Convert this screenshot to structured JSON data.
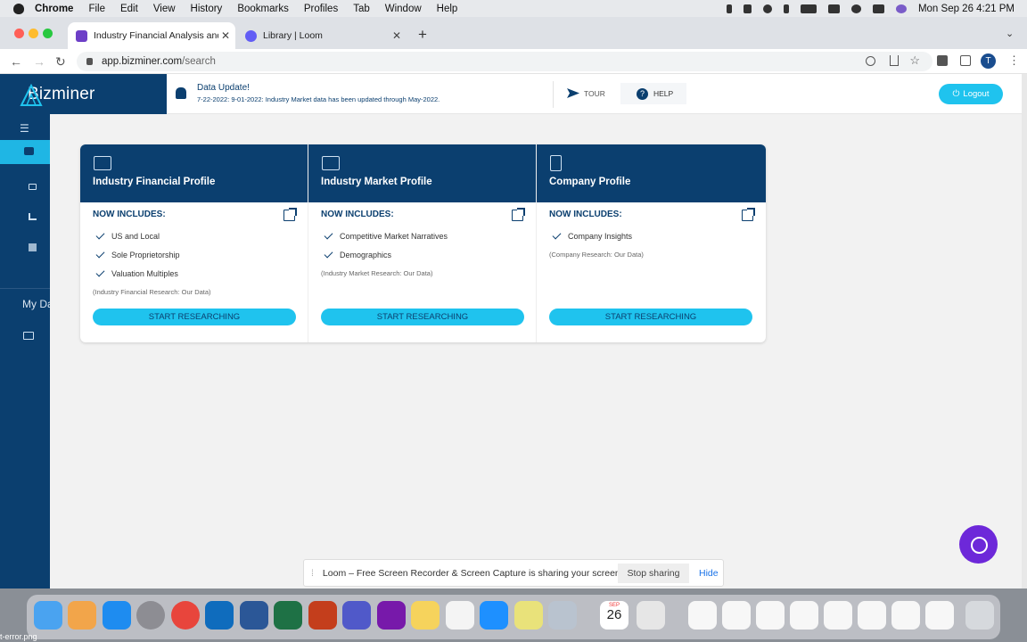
{
  "menubar": {
    "app": "Chrome",
    "items": [
      "File",
      "Edit",
      "View",
      "History",
      "Bookmarks",
      "Profiles",
      "Tab",
      "Window",
      "Help"
    ],
    "clock": "Mon Sep 26  4:21 PM"
  },
  "browser": {
    "tabs": [
      {
        "title": "Industry Financial Analysis and",
        "favicon_color": "#6d3fc7"
      },
      {
        "title": "Library | Loom",
        "favicon_color": "#625df5"
      }
    ],
    "url_host": "app.bizminer.com",
    "url_path": "/search",
    "profile_initial": "T"
  },
  "app": {
    "logo": "Bizminer",
    "notice_title": "Data Update!",
    "notice_text": "7-22-2022: 9-01-2022: Industry Market data has been updated through May-2022.",
    "tour": "TOUR",
    "help": "HELP",
    "logout": "Logout",
    "my_data": "My Da"
  },
  "cards": [
    {
      "title": "Industry Financial Profile",
      "includes_label": "NOW INCLUDES:",
      "features": [
        "US and Local",
        "Sole Proprietorship",
        "Valuation Multiples"
      ],
      "note": "(Industry Financial Research: Our Data)",
      "button": "START RESEARCHING"
    },
    {
      "title": "Industry Market Profile",
      "includes_label": "NOW INCLUDES:",
      "features": [
        "Competitive Market Narratives",
        "Demographics"
      ],
      "note": "(Industry Market Research: Our Data)",
      "button": "START RESEARCHING"
    },
    {
      "title": "Company Profile",
      "includes_label": "NOW INCLUDES:",
      "features": [
        "Company Insights"
      ],
      "note": "(Company Research: Our Data)",
      "button": "START RESEARCHING"
    }
  ],
  "loom_bar": {
    "message": "Loom – Free Screen Recorder & Screen Capture is sharing your screen.",
    "stop": "Stop sharing",
    "hide": "Hide"
  },
  "dock": {
    "calendar_month": "SEP",
    "calendar_day": "26",
    "desktop_file": "t-error.png"
  },
  "colors": {
    "navy": "#0b3f6f",
    "cyan": "#1fc3ee",
    "chat": "#6d28d9"
  }
}
